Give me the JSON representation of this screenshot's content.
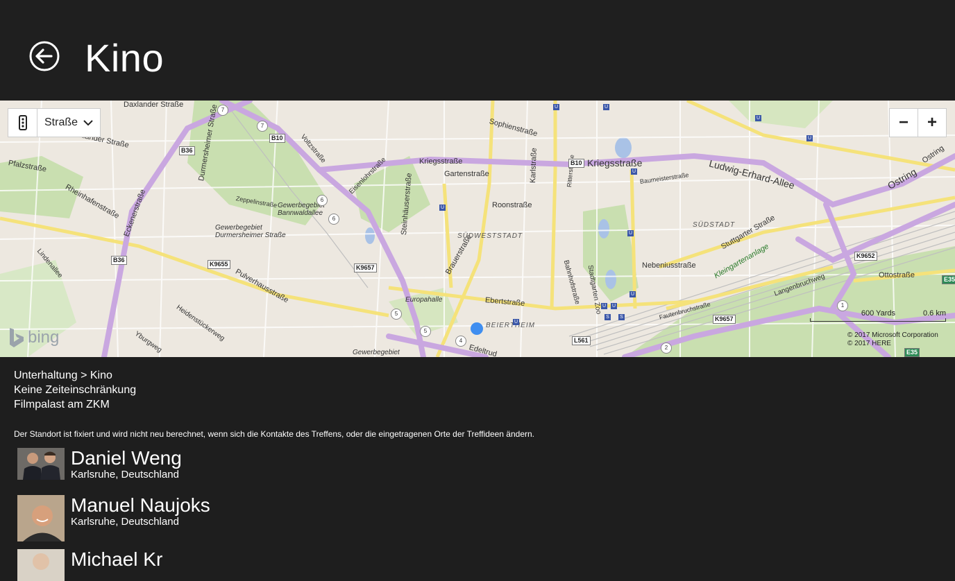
{
  "header": {
    "title": "Kino",
    "back_icon": "back-arrow-icon"
  },
  "map": {
    "style_selector": {
      "icon": "map-style-icon",
      "value": "Straße"
    },
    "zoom": {
      "out_label": "−",
      "in_label": "+"
    },
    "logo": "bing",
    "scale": {
      "imperial": "600 Yards",
      "metric": "0.6 km"
    },
    "copyright": [
      "© 2017 Microsoft Corporation",
      "© 2017 HERE"
    ],
    "pin_color": "#3f8ef0",
    "labels": {
      "kriegsstrasse_left": "Kriegsstraße",
      "kriegsstrasse_right": "Kriegsstraße",
      "ludwig": "Ludwig-Erhard-Allee",
      "ostring": "Ostring",
      "ostring2": "Ostring",
      "daxlander": "Daxlander Straße",
      "daxlander2": "xlander Straße",
      "pfalz": "Pfalzstraße",
      "rheinhafen": "Rheinhafenstraße",
      "ecken": "Eckenerstraße",
      "durmersheimer": "Durmersheimer Straße",
      "zeppelin": "Zeppelinstraße",
      "gewerbe1": "Gewerbegebiet Bannwaldallee",
      "gewerbe2": "Gewerbegebiet Durmersheimer Straße",
      "voltz": "Voltzstraße",
      "eisenlohr": "Eisenlohrstraße",
      "garten": "Gartenstraße",
      "sophien": "Sophienstraße",
      "roon": "Roonstraße",
      "karl": "Karlstraße",
      "steinhauser": "Steinhäuserstraße",
      "suedweststadt": "SÜDWESTSTADT",
      "suedstadt": "SÜDSTADT",
      "bauer": "Brauerstraße",
      "ebert": "Ebertstraße",
      "europahalle": "Europahalle",
      "beiertheim": "BEIERTHEIM",
      "pulverhaus": "Pulverhausstraße",
      "heidenstuecker": "Heidenstückerweg",
      "lindenallee": "Lindenallee",
      "yburg": "Yburgweg",
      "baumeister": "Baumeisterstraße",
      "ritter": "Ritterstraße",
      "bahnhof": "Bahnhofstraße",
      "stadtgarten": "Stadtgarten Zoo",
      "nebenius": "Nebeniusstraße",
      "stuttgarter": "Stuttgarter Straße",
      "kleingarten": "Kleingartenanlage",
      "otto": "Ottostraße",
      "langenbruch": "Langenbruchweg",
      "fautenbruch": "Fautenbruchstraße",
      "edeltrud": "Edeltrud",
      "gewerbe3": "Gewerbegebiet",
      "weg": "weg"
    },
    "shields": [
      "B36",
      "B10",
      "B10",
      "B36",
      "K9655",
      "K9657",
      "K9652",
      "K9657",
      "L561",
      "E35",
      "E35"
    ],
    "circles": [
      "7",
      "7",
      "6",
      "6",
      "5",
      "5",
      "4",
      "1",
      "2"
    ]
  },
  "details": {
    "category": "Unterhaltung > Kino",
    "time": "Keine Zeiteinschränkung",
    "place": "Filmpalast am ZKM"
  },
  "note": "Der Standort ist fixiert und wird nicht neu berechnet, wenn sich die Kontakte des Treffens, oder die eingetragenen Orte der Treffideen ändern.",
  "contacts": [
    {
      "name": "Daniel Weng",
      "location": "Karlsruhe, Deutschland"
    },
    {
      "name": "Manuel Naujoks",
      "location": "Karlsruhe, Deutschland"
    },
    {
      "name": "Michael Kr",
      "location": ""
    }
  ]
}
